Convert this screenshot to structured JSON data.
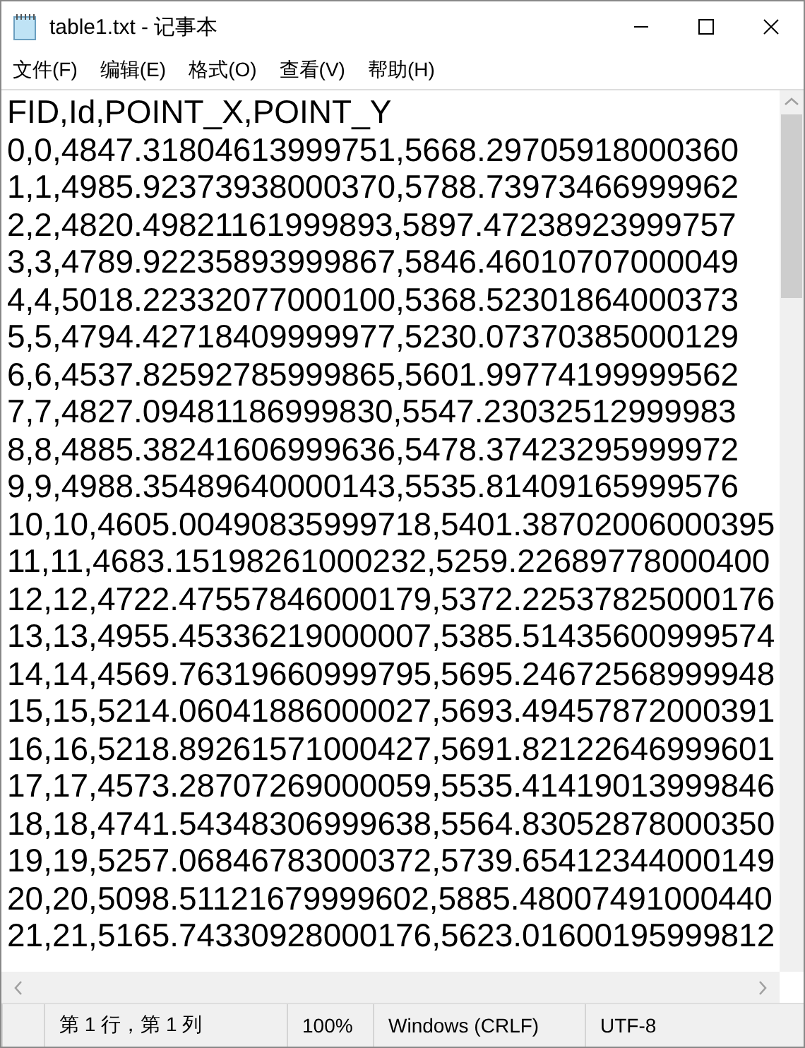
{
  "window": {
    "title": "table1.txt - 记事本"
  },
  "menu": [
    "文件(F)",
    "编辑(E)",
    "格式(O)",
    "查看(V)",
    "帮助(H)"
  ],
  "editor": {
    "lines": [
      "FID,Id,POINT_X,POINT_Y",
      "0,0,4847.31804613999751,5668.29705918000360",
      "1,1,4985.92373938000370,5788.73973466999962",
      "2,2,4820.49821161999893,5897.47238923999757",
      "3,3,4789.92235893999867,5846.46010707000049",
      "4,4,5018.22332077000100,5368.52301864000373",
      "5,5,4794.42718409999977,5230.07370385000129",
      "6,6,4537.82592785999865,5601.99774199999562",
      "7,7,4827.09481186999830,5547.23032512999983",
      "8,8,4885.38241606999636,5478.37423295999972",
      "9,9,4988.35489640000143,5535.81409165999576",
      "10,10,4605.00490835999718,5401.38702006000395",
      "11,11,4683.15198261000232,5259.22689778000400",
      "12,12,4722.47557846000179,5372.22537825000176",
      "13,13,4955.45336219000007,5385.51435600999574",
      "14,14,4569.76319660999795,5695.24672568999948",
      "15,15,5214.06041886000027,5693.49457872000391",
      "16,16,5218.89261571000427,5691.82122646999601",
      "17,17,4573.28707269000059,5535.41419013999846",
      "18,18,4741.54348306999638,5564.83052878000350",
      "19,19,5257.06846783000372,5739.65412344000149",
      "20,20,5098.51121679999602,5885.48007491000440",
      "21,21,5165.74330928000176,5623.01600195999812"
    ]
  },
  "status_bar": {
    "position": "第 1 行，第 1 列",
    "zoom": "100%",
    "line_ending": "Windows (CRLF)",
    "encoding": "UTF-8"
  }
}
